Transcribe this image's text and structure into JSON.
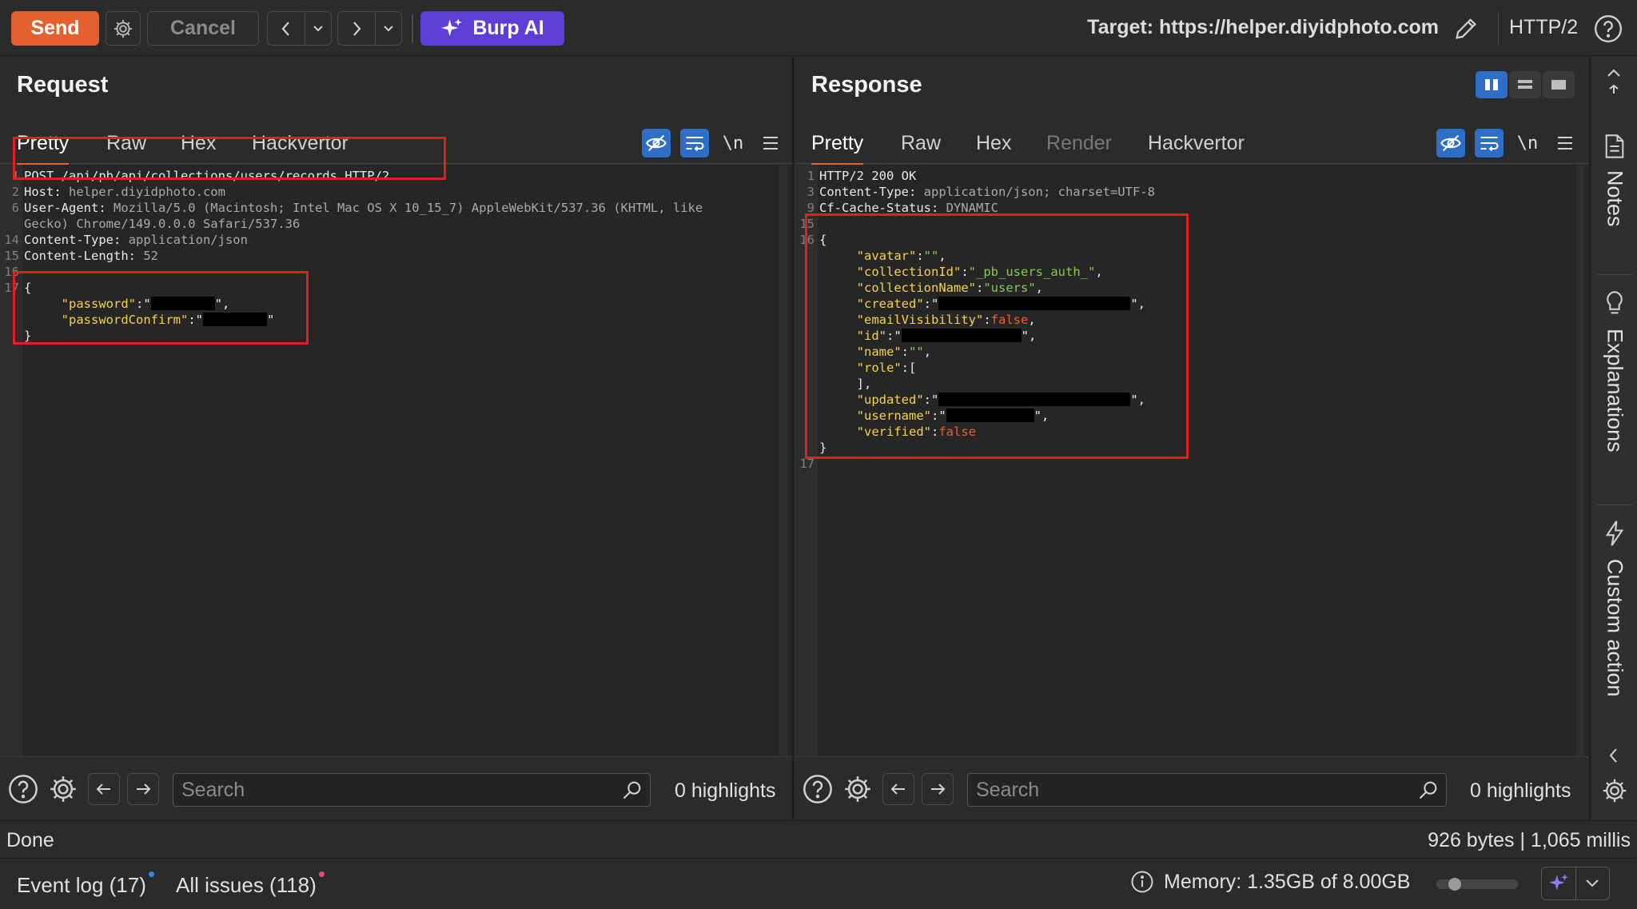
{
  "toolbar": {
    "send_label": "Send",
    "cancel_label": "Cancel",
    "burp_ai_label": "Burp AI",
    "target_label": "Target: https://helper.diyidphoto.com",
    "http_version": "HTTP/2"
  },
  "request": {
    "title": "Request",
    "tabs": [
      "Pretty",
      "Raw",
      "Hex",
      "Hackvertor"
    ],
    "newline_toggle": "\\n",
    "lines": [
      {
        "n": "1",
        "parts": [
          {
            "t": "POST /api/pb/api/collections/users/records HTTP/2",
            "c": "lc"
          }
        ]
      },
      {
        "n": "2",
        "parts": [
          {
            "t": "Host: ",
            "c": "hk"
          },
          {
            "t": "helper.diyidphoto.com",
            "c": "hv"
          }
        ]
      },
      {
        "n": "6",
        "parts": [
          {
            "t": "User-Agent: ",
            "c": "hk"
          },
          {
            "t": "Mozilla/5.0 (Macintosh; Intel Mac OS X 10_15_7) AppleWebKit/537.36 (KHTML, like",
            "c": "hv"
          }
        ]
      },
      {
        "n": "",
        "parts": [
          {
            "t": "Gecko) Chrome/149.0.0.0 Safari/537.36",
            "c": "hv"
          }
        ]
      },
      {
        "n": "14",
        "parts": [
          {
            "t": "Content-Type: ",
            "c": "hk"
          },
          {
            "t": "application/json",
            "c": "hv"
          }
        ]
      },
      {
        "n": "15",
        "parts": [
          {
            "t": "Content-Length: ",
            "c": "hk"
          },
          {
            "t": "52",
            "c": "hv"
          }
        ]
      },
      {
        "n": "16",
        "parts": []
      },
      {
        "n": "17",
        "parts": [
          {
            "t": "{",
            "c": "lc"
          }
        ]
      },
      {
        "n": "",
        "parts": [
          {
            "t": "     ",
            "c": "lc"
          },
          {
            "t": "\"password\"",
            "c": "jk"
          },
          {
            "t": ":\"",
            "c": "lc"
          },
          {
            "r": 80
          },
          {
            "t": "\",",
            "c": "lc"
          }
        ]
      },
      {
        "n": "",
        "parts": [
          {
            "t": "     ",
            "c": "lc"
          },
          {
            "t": "\"passwordConfirm\"",
            "c": "jk"
          },
          {
            "t": ":\"",
            "c": "lc"
          },
          {
            "r": 80
          },
          {
            "t": "\"",
            "c": "lc"
          }
        ]
      },
      {
        "n": "",
        "parts": [
          {
            "t": "}",
            "c": "lc"
          }
        ]
      }
    ]
  },
  "response": {
    "title": "Response",
    "tabs": [
      "Pretty",
      "Raw",
      "Hex",
      "Render",
      "Hackvertor"
    ],
    "newline_toggle": "\\n",
    "lines": [
      {
        "n": "1",
        "parts": [
          {
            "t": "HTTP/2 200 OK",
            "c": "lc"
          }
        ]
      },
      {
        "n": "3",
        "parts": [
          {
            "t": "Content-Type: ",
            "c": "hk"
          },
          {
            "t": "application/json; charset=UTF-8",
            "c": "hv"
          }
        ]
      },
      {
        "n": "9",
        "parts": [
          {
            "t": "Cf-Cache-Status: ",
            "c": "hk"
          },
          {
            "t": "DYNAMIC",
            "c": "hv"
          }
        ]
      },
      {
        "n": "15",
        "parts": []
      },
      {
        "n": "16",
        "parts": [
          {
            "t": "{",
            "c": "lc"
          }
        ]
      },
      {
        "n": "",
        "parts": [
          {
            "t": "     ",
            "c": "lc"
          },
          {
            "t": "\"avatar\"",
            "c": "jk"
          },
          {
            "t": ":",
            "c": "lc"
          },
          {
            "t": "\"\"",
            "c": "js"
          },
          {
            "t": ",",
            "c": "lc"
          }
        ]
      },
      {
        "n": "",
        "parts": [
          {
            "t": "     ",
            "c": "lc"
          },
          {
            "t": "\"collectionId\"",
            "c": "jk"
          },
          {
            "t": ":",
            "c": "lc"
          },
          {
            "t": "\"_pb_users_auth_\"",
            "c": "js"
          },
          {
            "t": ",",
            "c": "lc"
          }
        ]
      },
      {
        "n": "",
        "parts": [
          {
            "t": "     ",
            "c": "lc"
          },
          {
            "t": "\"collectionName\"",
            "c": "jk"
          },
          {
            "t": ":",
            "c": "lc"
          },
          {
            "t": "\"users\"",
            "c": "js"
          },
          {
            "t": ",",
            "c": "lc"
          }
        ]
      },
      {
        "n": "",
        "parts": [
          {
            "t": "     ",
            "c": "lc"
          },
          {
            "t": "\"created\"",
            "c": "jk"
          },
          {
            "t": ":\"",
            "c": "lc"
          },
          {
            "r": 240
          },
          {
            "t": "\",",
            "c": "lc"
          }
        ]
      },
      {
        "n": "",
        "parts": [
          {
            "t": "     ",
            "c": "lc"
          },
          {
            "t": "\"emailVisibility\"",
            "c": "jk"
          },
          {
            "t": ":",
            "c": "lc"
          },
          {
            "t": "false",
            "c": "jf"
          },
          {
            "t": ",",
            "c": "lc"
          }
        ]
      },
      {
        "n": "",
        "parts": [
          {
            "t": "     ",
            "c": "lc"
          },
          {
            "t": "\"id\"",
            "c": "jk"
          },
          {
            "t": ":\"",
            "c": "lc"
          },
          {
            "r": 150
          },
          {
            "t": "\",",
            "c": "lc"
          }
        ]
      },
      {
        "n": "",
        "parts": [
          {
            "t": "     ",
            "c": "lc"
          },
          {
            "t": "\"name\"",
            "c": "jk"
          },
          {
            "t": ":",
            "c": "lc"
          },
          {
            "t": "\"\"",
            "c": "js"
          },
          {
            "t": ",",
            "c": "lc"
          }
        ]
      },
      {
        "n": "",
        "parts": [
          {
            "t": "     ",
            "c": "lc"
          },
          {
            "t": "\"role\"",
            "c": "jk"
          },
          {
            "t": ":[",
            "c": "lc"
          }
        ]
      },
      {
        "n": "",
        "parts": [
          {
            "t": "     ],",
            "c": "lc"
          }
        ]
      },
      {
        "n": "",
        "parts": [
          {
            "t": "     ",
            "c": "lc"
          },
          {
            "t": "\"updated\"",
            "c": "jk"
          },
          {
            "t": ":\"",
            "c": "lc"
          },
          {
            "r": 240
          },
          {
            "t": "\",",
            "c": "lc"
          }
        ]
      },
      {
        "n": "",
        "parts": [
          {
            "t": "     ",
            "c": "lc"
          },
          {
            "t": "\"username\"",
            "c": "jk"
          },
          {
            "t": ":\"",
            "c": "lc"
          },
          {
            "r": 110
          },
          {
            "t": "\",",
            "c": "lc"
          }
        ]
      },
      {
        "n": "",
        "parts": [
          {
            "t": "     ",
            "c": "lc"
          },
          {
            "t": "\"verified\"",
            "c": "jk"
          },
          {
            "t": ":",
            "c": "lc"
          },
          {
            "t": "false",
            "c": "jf"
          }
        ]
      },
      {
        "n": "",
        "parts": [
          {
            "t": "}",
            "c": "lc"
          }
        ]
      },
      {
        "n": "17",
        "parts": []
      }
    ]
  },
  "search": {
    "placeholder": "Search",
    "request_highlights": "0 highlights",
    "response_highlights": "0 highlights"
  },
  "sidebar": {
    "items": [
      "Notes",
      "Explanations",
      "Custom action"
    ]
  },
  "status": {
    "text": "Done",
    "response_meta": "926 bytes | 1,065 millis"
  },
  "bottom": {
    "event_log": "Event log (17)",
    "all_issues": "All issues (118)",
    "memory": "Memory: 1.35GB of 8.00GB",
    "memory_usage_fraction": 0.17
  },
  "colors": {
    "accent": "#e3612f",
    "burp_ai": "#5b3fd6",
    "toggle_blue": "#2f6ec6",
    "annotation_red": "#e02020"
  }
}
